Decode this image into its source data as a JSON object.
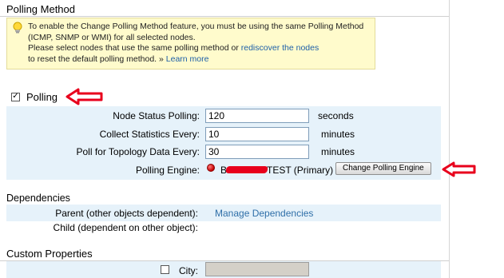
{
  "polling_method": {
    "title": "Polling Method",
    "info_line1": "To enable the Change Polling Method feature, you must be using the same Polling Method",
    "info_line2": "(ICMP, SNMP or WMI) for all selected nodes.",
    "info_line3_prefix": "Please select nodes that use the same polling method or ",
    "info_line3_link": "rediscover the nodes",
    "info_line4_prefix": "to reset the default polling method. » ",
    "info_line4_link": "Learn more",
    "icon": "lightbulb-icon"
  },
  "polling": {
    "checkbox_label": "Polling",
    "checked": true,
    "node_status_label": "Node Status Polling:",
    "node_status_value": "120",
    "node_status_unit": "seconds",
    "collect_stats_label": "Collect Statistics Every:",
    "collect_stats_value": "10",
    "collect_stats_unit": "minutes",
    "topology_label": "Poll for Topology Data Every:",
    "topology_value": "30",
    "topology_unit": "minutes",
    "engine_label": "Polling Engine:",
    "engine_name_visible": "B",
    "engine_name_tail": "TEST (Primary)",
    "engine_status_color": "#d00000",
    "change_engine_button": "Change Polling Engine"
  },
  "dependencies": {
    "title": "Dependencies",
    "parent_label": "Parent (other objects dependent):",
    "parent_link": "Manage Dependencies",
    "child_label": "Child (dependent on other object):"
  },
  "custom_properties": {
    "title": "Custom Properties",
    "city_label": "City:",
    "city_checked": false
  },
  "colors": {
    "accent_blue_band": "#e6f2fa",
    "warning_bg": "#fffbcc",
    "annotation_arrow": "#e8001c",
    "link": "#2f6fa8"
  }
}
